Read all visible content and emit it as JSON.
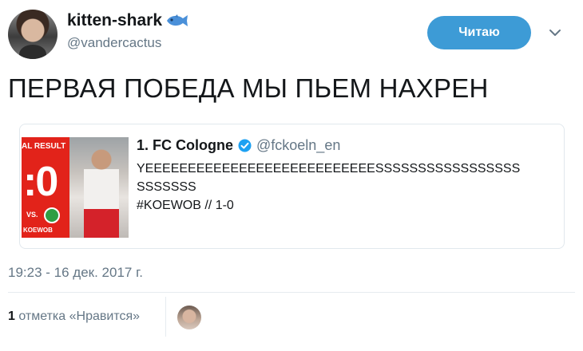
{
  "author": {
    "display_name": "kitten-shark",
    "emoji_icon": "fish-icon",
    "username": "@vandercactus"
  },
  "follow_button": {
    "label": "Читаю",
    "color": "#3d9bd6"
  },
  "tweet": {
    "text": "ПЕРВАЯ ПОБЕДА МЫ ПЬЕМ НАХРЕН",
    "timestamp": "19:23 - 16 дек. 2017 г."
  },
  "quoted_tweet": {
    "name": "1. FC Cologne",
    "verified_icon": "verified-badge-icon",
    "handle": "@fckoeln_en",
    "body_line1": "YEEEEEEEEEEEEEEEEEEEEEEEEEEESSSSSSSSSSSSSSSSS",
    "body_line2": "SSSSSSS",
    "body_line3": "#KOEWOB // 1-0",
    "thumbnail": {
      "top_text": "AL RESULT",
      "score": ":0",
      "vs": "VS.",
      "hashtag": "KOEWOB",
      "accent_color": "#e2231a"
    }
  },
  "engagement": {
    "likes_number": "1",
    "likes_label": "отметка «Нравится»"
  }
}
